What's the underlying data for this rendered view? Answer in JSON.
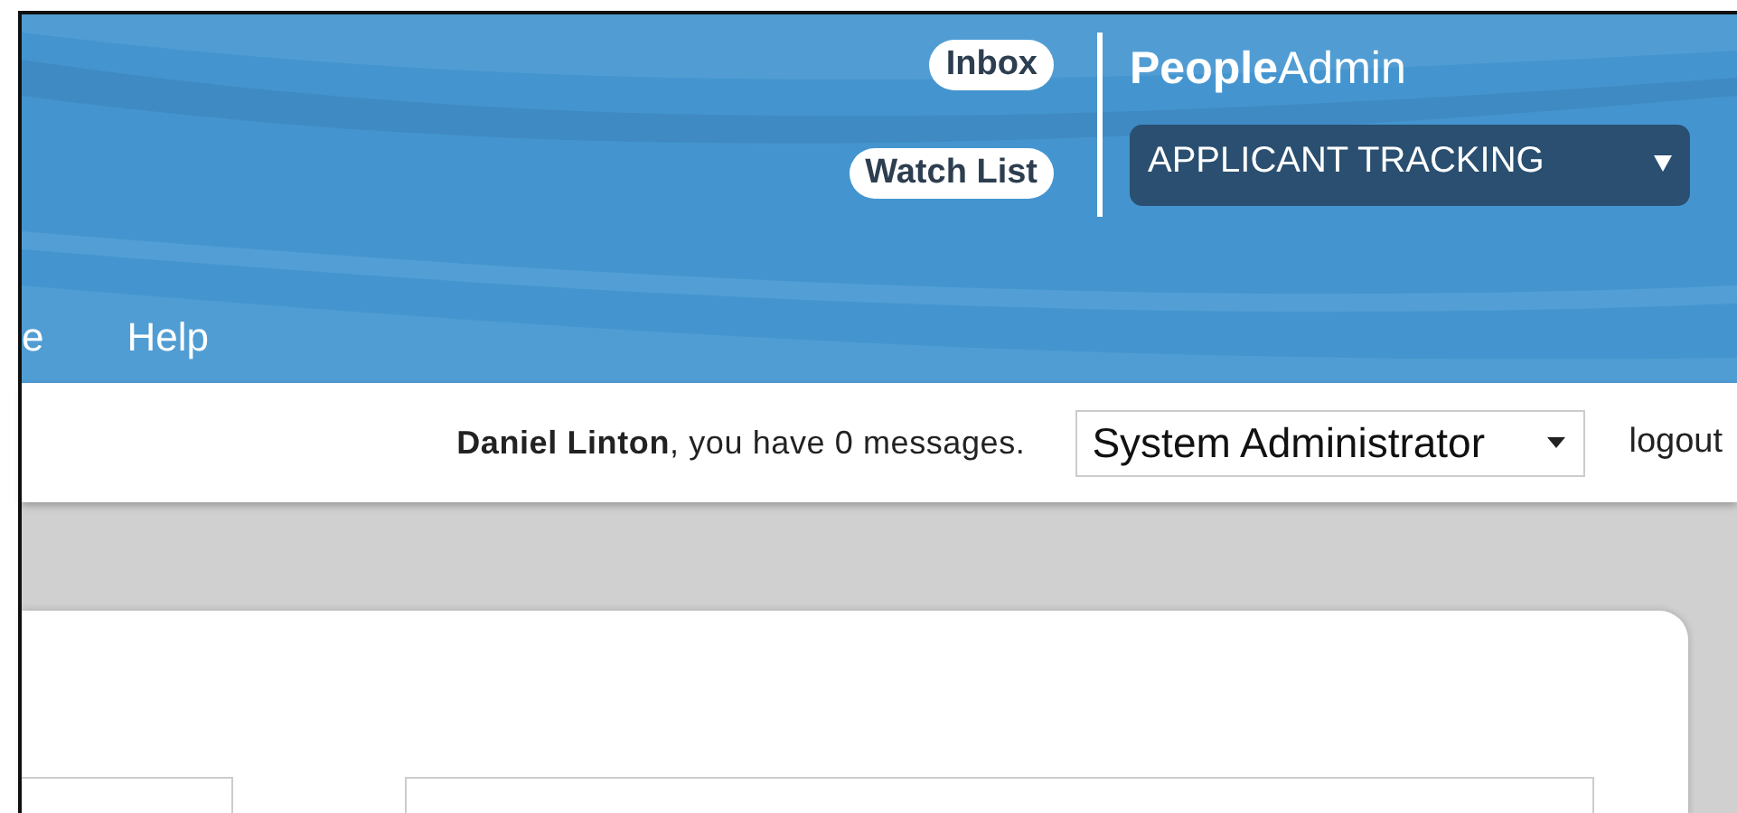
{
  "header": {
    "nav_items": [
      "e",
      "Help"
    ],
    "quick_links": [
      "Inbox",
      "Watch List"
    ],
    "brand": "**People**Admin",
    "product_select": {
      "value": "APPLICANT TRACKING"
    }
  },
  "user_bar": {
    "greeting": "**Daniel Linton**, you have 0 messages.",
    "role_select": {
      "value": "System Administrator"
    },
    "logout": "logout"
  }
}
